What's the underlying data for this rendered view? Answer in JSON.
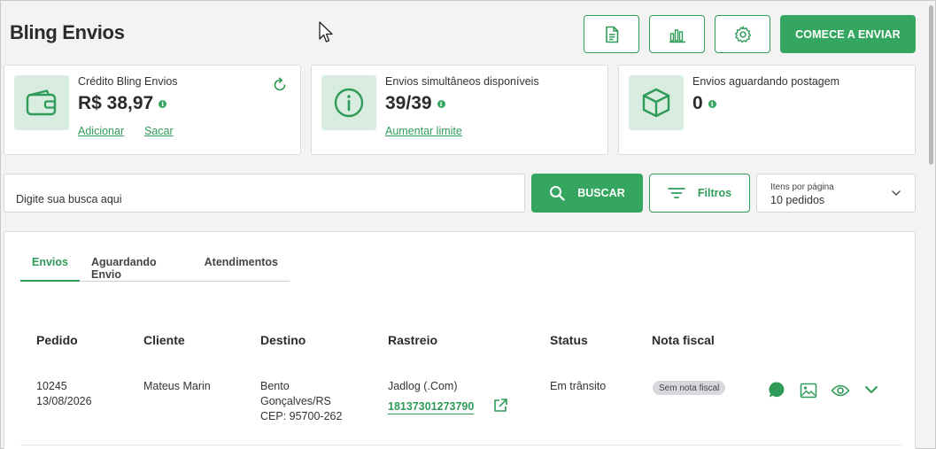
{
  "header": {
    "title": "Bling Envios",
    "icon_buttons": [
      "document-icon",
      "bar-chart-icon",
      "gear-icon"
    ],
    "start_label": "COMECE A ENVIAR"
  },
  "cards": {
    "credit": {
      "label": "Crédito Bling Envios",
      "value": "R$ 38,97",
      "add_link": "Adicionar",
      "withdraw_link": "Sacar",
      "icon": "wallet-icon"
    },
    "shipments": {
      "label": "Envios simultâneos disponíveis",
      "value": "39/39",
      "link": "Aumentar limite",
      "icon": "info-circle-icon"
    },
    "awaiting": {
      "label": "Envios aguardando postagem",
      "value": "0",
      "icon": "box-icon"
    }
  },
  "search": {
    "placeholder": "Digite sua busca aqui",
    "button_label": "BUSCAR",
    "filter_label": "Filtros"
  },
  "per_page": {
    "label": "Itens por página",
    "value": "10 pedidos"
  },
  "tabs": [
    {
      "label": "Envios",
      "active": true
    },
    {
      "label": "Aguardando Envio",
      "active": false
    },
    {
      "label": "Atendimentos",
      "active": false
    }
  ],
  "table": {
    "headers": [
      "Pedido",
      "Cliente",
      "Destino",
      "Rastreio",
      "Status",
      "Nota fiscal"
    ],
    "rows": [
      {
        "order": "10245",
        "date": "13/08/2026",
        "client": "Mateus Marin",
        "dest_city": "Bento",
        "dest_city2": "Gonçalves/RS",
        "dest_cep": "CEP: 95700-262",
        "carrier": "Jadlog (.Com)",
        "tracking": "18137301273790",
        "status": "Em trânsito",
        "invoice": "Sem nota fiscal"
      }
    ]
  },
  "colors": {
    "accent": "#35a65f",
    "accent_dark": "#2f9b58",
    "icon_bg": "#d8eddf"
  }
}
